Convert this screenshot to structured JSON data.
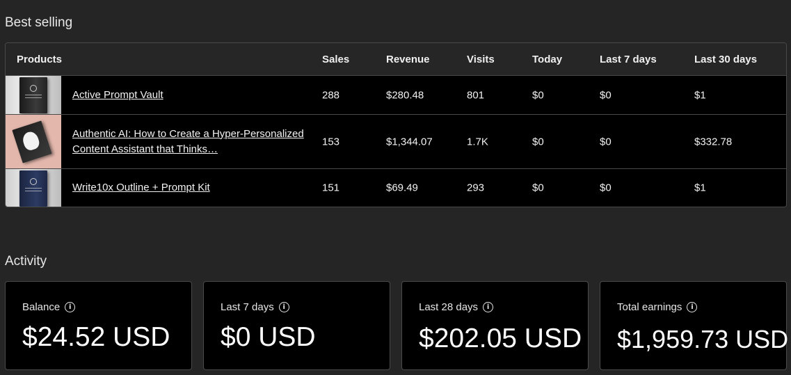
{
  "best_selling": {
    "title": "Best selling",
    "columns": {
      "products": "Products",
      "sales": "Sales",
      "revenue": "Revenue",
      "visits": "Visits",
      "today": "Today",
      "last7": "Last 7 days",
      "last30": "Last 30 days"
    },
    "rows": [
      {
        "name": "Active Prompt Vault",
        "sales": "288",
        "revenue": "$280.48",
        "visits": "801",
        "today": "$0",
        "last7": "$0",
        "last30": "$1"
      },
      {
        "name": "Authentic AI: How to Create a Hyper-Personalized Content Assistant that Thinks…",
        "sales": "153",
        "revenue": "$1,344.07",
        "visits": "1.7K",
        "today": "$0",
        "last7": "$0",
        "last30": "$332.78"
      },
      {
        "name": "Write10x Outline + Prompt Kit",
        "sales": "151",
        "revenue": "$69.49",
        "visits": "293",
        "today": "$0",
        "last7": "$0",
        "last30": "$1"
      }
    ]
  },
  "activity": {
    "title": "Activity",
    "cards": [
      {
        "label": "Balance",
        "value": "$24.52 USD",
        "icon": "info-icon"
      },
      {
        "label": "Last 7 days",
        "value": "$0 USD",
        "icon": "info-icon"
      },
      {
        "label": "Last 28 days",
        "value": "$202.05 USD",
        "icon": "info-icon"
      },
      {
        "label": "Total earnings",
        "value": "$1,959.73 USD",
        "icon": "info-icon"
      }
    ]
  },
  "colors": {
    "page_bg": "#252525",
    "table_bg": "#000000",
    "border": "#4a4a4a",
    "thumb_pink": "#e3b7ac"
  }
}
